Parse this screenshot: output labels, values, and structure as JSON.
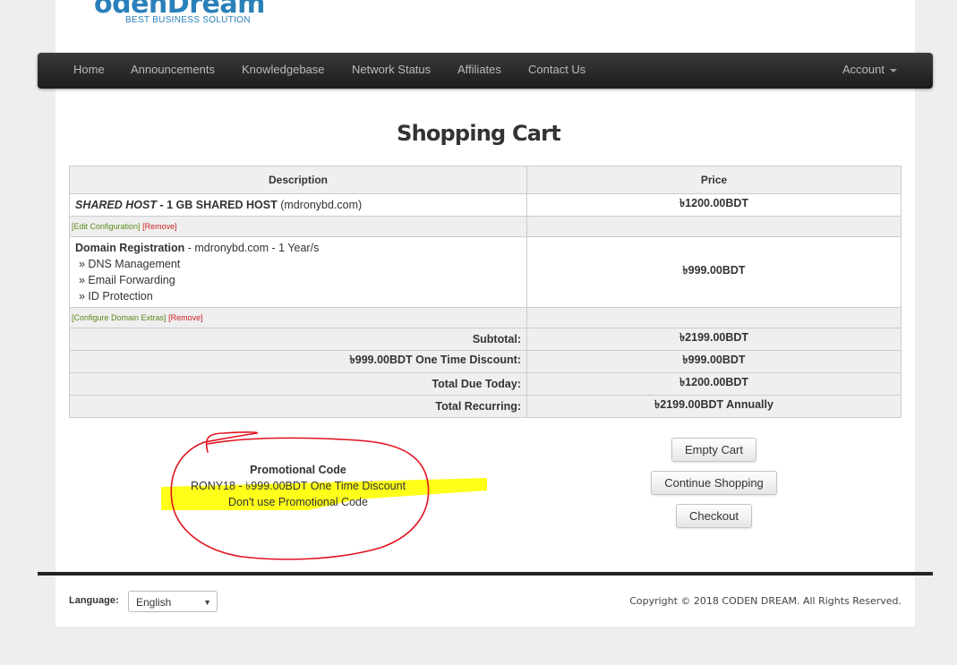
{
  "logo": {
    "name": "odenDream",
    "tagline": "BEST BUSINESS SOLUTION"
  },
  "nav": {
    "items": [
      "Home",
      "Announcements",
      "Knowledgebase",
      "Network Status",
      "Affiliates",
      "Contact Us"
    ],
    "account": "Account"
  },
  "page_title": "Shopping Cart",
  "table": {
    "headers": {
      "description": "Description",
      "price": "Price"
    },
    "item1": {
      "product": "SHARED HOST",
      "sep": " - ",
      "plan": "1 GB SHARED HOST",
      "domain": " (mdronybd.com)",
      "price": "৳1200.00BDT",
      "edit_link": "[Edit Configuration]",
      "remove_link": "[Remove]"
    },
    "item2": {
      "title": "Domain Registration",
      "detail": " - mdronybd.com - 1 Year/s",
      "addons": [
        "» DNS Management",
        "» Email Forwarding",
        "» ID Protection"
      ],
      "price": "৳999.00BDT",
      "configure_link": "[Configure Domain Extras]",
      "remove_link": "[Remove]"
    },
    "totals": [
      {
        "label": "Subtotal:",
        "value": "৳2199.00BDT"
      },
      {
        "label": "৳999.00BDT One Time Discount:",
        "value": "৳999.00BDT"
      },
      {
        "label": "Total Due Today:",
        "value": "৳1200.00BDT"
      },
      {
        "label": "Total Recurring:",
        "value": "৳2199.00BDT Annually"
      }
    ]
  },
  "promo": {
    "title": "Promotional Code",
    "applied": "RONY18 - ৳999.00BDT One Time Discount",
    "remove_link": "Don't use Promotional Code"
  },
  "buttons": {
    "empty": "Empty Cart",
    "continue": "Continue Shopping",
    "checkout": "Checkout"
  },
  "footer": {
    "language_label": "Language:",
    "language_value": "English",
    "copyright": "Copyright © 2018 CODEN DREAM. All Rights Reserved."
  },
  "colors": {
    "brand": "#2a80b9",
    "highlight": "#ffff1a",
    "annotation": "#e0141e"
  }
}
